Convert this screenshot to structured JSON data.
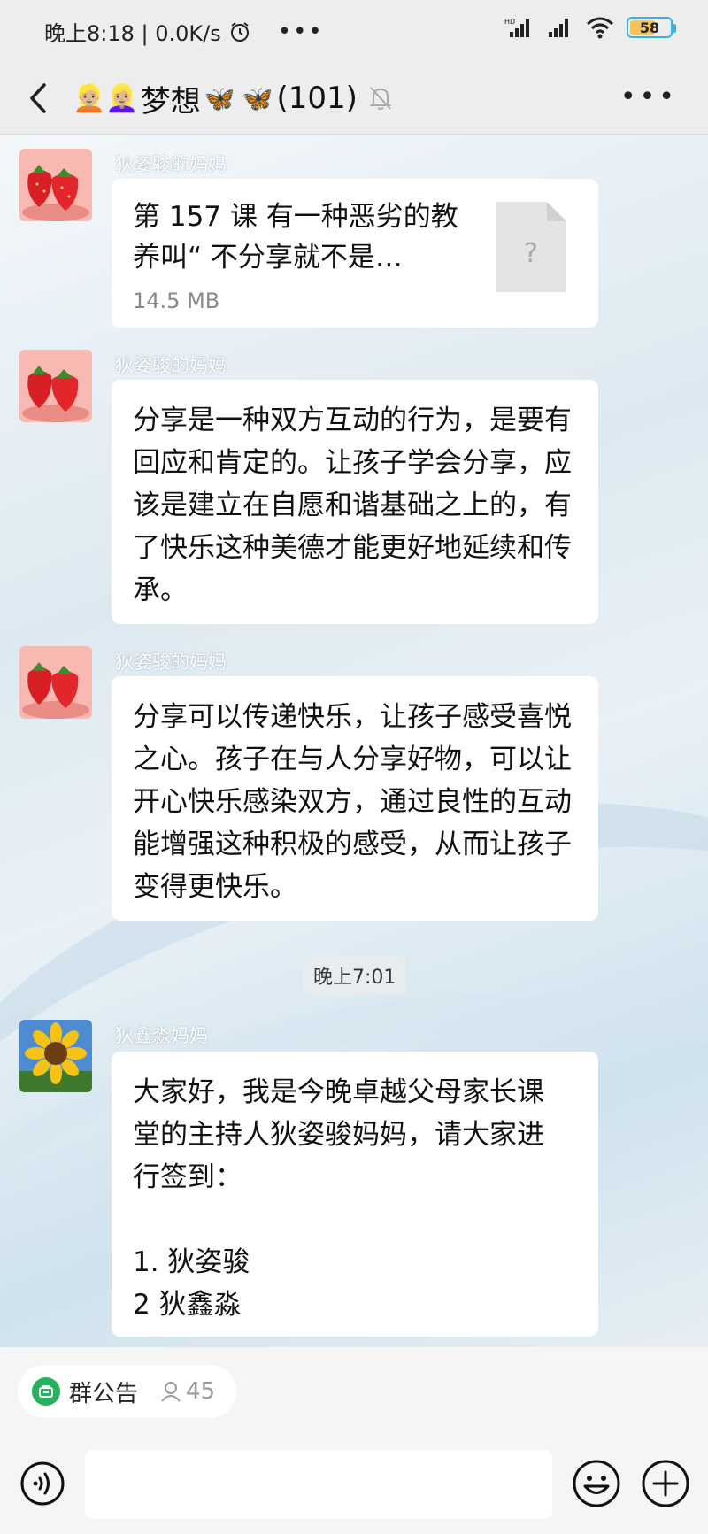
{
  "status_bar": {
    "time_speed": "晚上8:18 | 0.0K/s",
    "battery": "58",
    "battery_level": 0.58,
    "network": "HD"
  },
  "header": {
    "title_name": "梦想",
    "title_count": "(101)",
    "title_emojis": "👱🏼👱🏼‍♀️",
    "butterflies": "🦋"
  },
  "messages": [
    {
      "sender": "狄姿骏的妈妈",
      "type": "file",
      "file_name": "第 157 课 有一种恶劣的教养叫“ 不分享就不是…",
      "file_size": "14.5 MB"
    },
    {
      "sender": "狄姿骏的妈妈",
      "type": "text",
      "text": "分享是一种双方互动的行为，是要有回应和肯定的。让孩子学会分享，应该是建立在自愿和谐基础之上的，有了快乐这种美德才能更好地延续和传承。"
    },
    {
      "sender": "狄姿骏的妈妈",
      "type": "text",
      "text": "分享可以传递快乐，让孩子感受喜悦之心。孩子在与人分享好物，可以让开心快乐感染双方，通过良性的互动能增强这种积极的感受，从而让孩子变得更快乐。"
    },
    {
      "sender": "狄鑫淼妈妈",
      "type": "text",
      "lines": [
        "大家好，我是今晚卓越父母家长课",
        "堂的主持人狄姿骏妈妈，请大家进",
        "行签到：",
        "",
        "1. 狄姿骏",
        "2 狄鑫淼"
      ]
    }
  ],
  "timestamp": "晚上7:01",
  "notice": {
    "label": "群公告",
    "count": "45"
  },
  "colors": {
    "bubble": "#ffffff",
    "notice_green": "#26b15e",
    "battery_border": "#3cb1e8"
  }
}
